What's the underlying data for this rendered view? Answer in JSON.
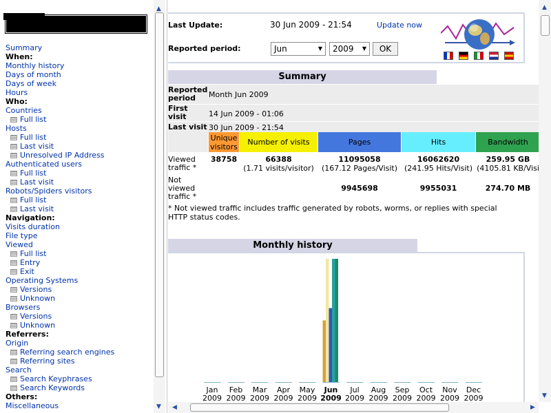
{
  "menu": [
    {
      "label": "Summary",
      "kind": "link"
    },
    {
      "label": "When:",
      "kind": "hdr"
    },
    {
      "label": "Monthly history",
      "kind": "link"
    },
    {
      "label": "Days of month",
      "kind": "link"
    },
    {
      "label": "Days of week",
      "kind": "link"
    },
    {
      "label": "Hours",
      "kind": "link"
    },
    {
      "label": "Who:",
      "kind": "hdr"
    },
    {
      "label": "Countries",
      "kind": "link"
    },
    {
      "label": "Full list",
      "kind": "sub"
    },
    {
      "label": "Hosts",
      "kind": "link"
    },
    {
      "label": "Full list",
      "kind": "sub"
    },
    {
      "label": "Last visit",
      "kind": "sub"
    },
    {
      "label": "Unresolved IP Address",
      "kind": "sub"
    },
    {
      "label": "Authenticated users",
      "kind": "link"
    },
    {
      "label": "Full list",
      "kind": "sub"
    },
    {
      "label": "Last visit",
      "kind": "sub"
    },
    {
      "label": "Robots/Spiders visitors",
      "kind": "link"
    },
    {
      "label": "Full list",
      "kind": "sub"
    },
    {
      "label": "Last visit",
      "kind": "sub"
    },
    {
      "label": "Navigation:",
      "kind": "hdr"
    },
    {
      "label": "Visits duration",
      "kind": "link"
    },
    {
      "label": "File type",
      "kind": "link"
    },
    {
      "label": "Viewed",
      "kind": "link"
    },
    {
      "label": "Full list",
      "kind": "sub"
    },
    {
      "label": "Entry",
      "kind": "sub"
    },
    {
      "label": "Exit",
      "kind": "sub"
    },
    {
      "label": "Operating Systems",
      "kind": "link"
    },
    {
      "label": "Versions",
      "kind": "sub"
    },
    {
      "label": "Unknown",
      "kind": "sub"
    },
    {
      "label": "Browsers",
      "kind": "link"
    },
    {
      "label": "Versions",
      "kind": "sub"
    },
    {
      "label": "Unknown",
      "kind": "sub"
    },
    {
      "label": "Referrers:",
      "kind": "hdr"
    },
    {
      "label": "Origin",
      "kind": "link"
    },
    {
      "label": "Referring search engines",
      "kind": "sub"
    },
    {
      "label": "Referring sites",
      "kind": "sub"
    },
    {
      "label": "Search",
      "kind": "link"
    },
    {
      "label": "Search Keyphrases",
      "kind": "sub"
    },
    {
      "label": "Search Keywords",
      "kind": "sub"
    },
    {
      "label": "Others:",
      "kind": "hdr"
    },
    {
      "label": "Miscellaneous",
      "kind": "link"
    }
  ],
  "info": {
    "last_update_label": "Last Update:",
    "last_update_value": "30 Jun 2009 - 21:54",
    "update_now": "Update now",
    "reported_period_label": "Reported period:",
    "month_selected": "Jun",
    "year_selected": "2009",
    "ok_label": "OK",
    "flags": [
      {
        "name": "french-flag-icon",
        "colors": [
          "#0033cc",
          "#ffffff",
          "#dd0000"
        ],
        "dir": "v"
      },
      {
        "name": "german-flag-icon",
        "colors": [
          "#000000",
          "#dd0000",
          "#ffcc00"
        ],
        "dir": "h"
      },
      {
        "name": "italian-flag-icon",
        "colors": [
          "#009933",
          "#ffffff",
          "#dd0000"
        ],
        "dir": "v"
      },
      {
        "name": "dutch-flag-icon",
        "colors": [
          "#cc2233",
          "#ffffff",
          "#223399"
        ],
        "dir": "h"
      },
      {
        "name": "spanish-flag-icon",
        "colors": [
          "#cc1111",
          "#ffcc00",
          "#cc1111"
        ],
        "dir": "h"
      }
    ]
  },
  "summary": {
    "title": "Summary",
    "reported_period_label": "Reported period",
    "reported_period_value": "Month Jun 2009",
    "first_visit_label": "First visit",
    "first_visit_value": "14 Jun 2009 - 01:06",
    "last_visit_label": "Last visit",
    "last_visit_value": "30 Jun 2009 - 21:54",
    "columns": [
      {
        "label": "Unique visitors",
        "color": "#ff9933"
      },
      {
        "label": "Number of visits",
        "color": "#f4f000"
      },
      {
        "label": "Pages",
        "color": "#4477dd"
      },
      {
        "label": "Hits",
        "color": "#66eeff"
      },
      {
        "label": "Bandwidth",
        "color": "#2ea24f"
      }
    ],
    "viewed_label": "Viewed traffic *",
    "viewed": {
      "unique_visitors": "38758",
      "visits": "66388",
      "visits_sub": "(1.71 visits/visitor)",
      "pages": "11095058",
      "pages_sub": "(167.12 Pages/Visit)",
      "hits": "16062620",
      "hits_sub": "(241.95 Hits/Visit)",
      "bandwidth": "259.95 GB",
      "bandwidth_sub": "(4105.81 KB/Visi"
    },
    "not_viewed_label": "Not viewed traffic *",
    "not_viewed": {
      "pages": "9945698",
      "hits": "9955031",
      "bandwidth": "274.70 MB"
    },
    "note_line1": "* Not viewed traffic includes traffic generated by robots, worms, or replies with special",
    "note_line2": "HTTP status codes."
  },
  "monthly": {
    "title": "Monthly history"
  },
  "chart_data": {
    "type": "bar",
    "categories": [
      "Jan",
      "Feb",
      "Mar",
      "Apr",
      "May",
      "Jun",
      "Jul",
      "Aug",
      "Sep",
      "Oct",
      "Nov",
      "Dec"
    ],
    "years": [
      "2009",
      "2009",
      "2009",
      "2009",
      "2009",
      "2009",
      "2009",
      "2009",
      "2009",
      "2009",
      "2009",
      "2009"
    ],
    "highlight": "Jun",
    "series": [
      {
        "color": "#d8a040",
        "values": [
          0,
          0,
          0,
          0,
          0,
          0.5,
          0,
          0,
          0,
          0,
          0,
          0
        ]
      },
      {
        "color": "#f0e8a0",
        "values": [
          0,
          0,
          0,
          0,
          0,
          1.0,
          0,
          0,
          0,
          0,
          0,
          0
        ]
      },
      {
        "color": "#3355bb",
        "values": [
          0,
          0,
          0,
          0,
          0,
          0.6,
          0,
          0,
          0,
          0,
          0,
          0
        ]
      },
      {
        "color": "#2aa0a0",
        "values": [
          0,
          0,
          0,
          0,
          0,
          1.0,
          0,
          0,
          0,
          0,
          0,
          0
        ]
      },
      {
        "color": "#1a8a6a",
        "values": [
          0,
          0,
          0,
          0,
          0,
          1.0,
          0,
          0,
          0,
          0,
          0,
          0
        ]
      }
    ],
    "ylim": [
      0,
      1
    ]
  }
}
